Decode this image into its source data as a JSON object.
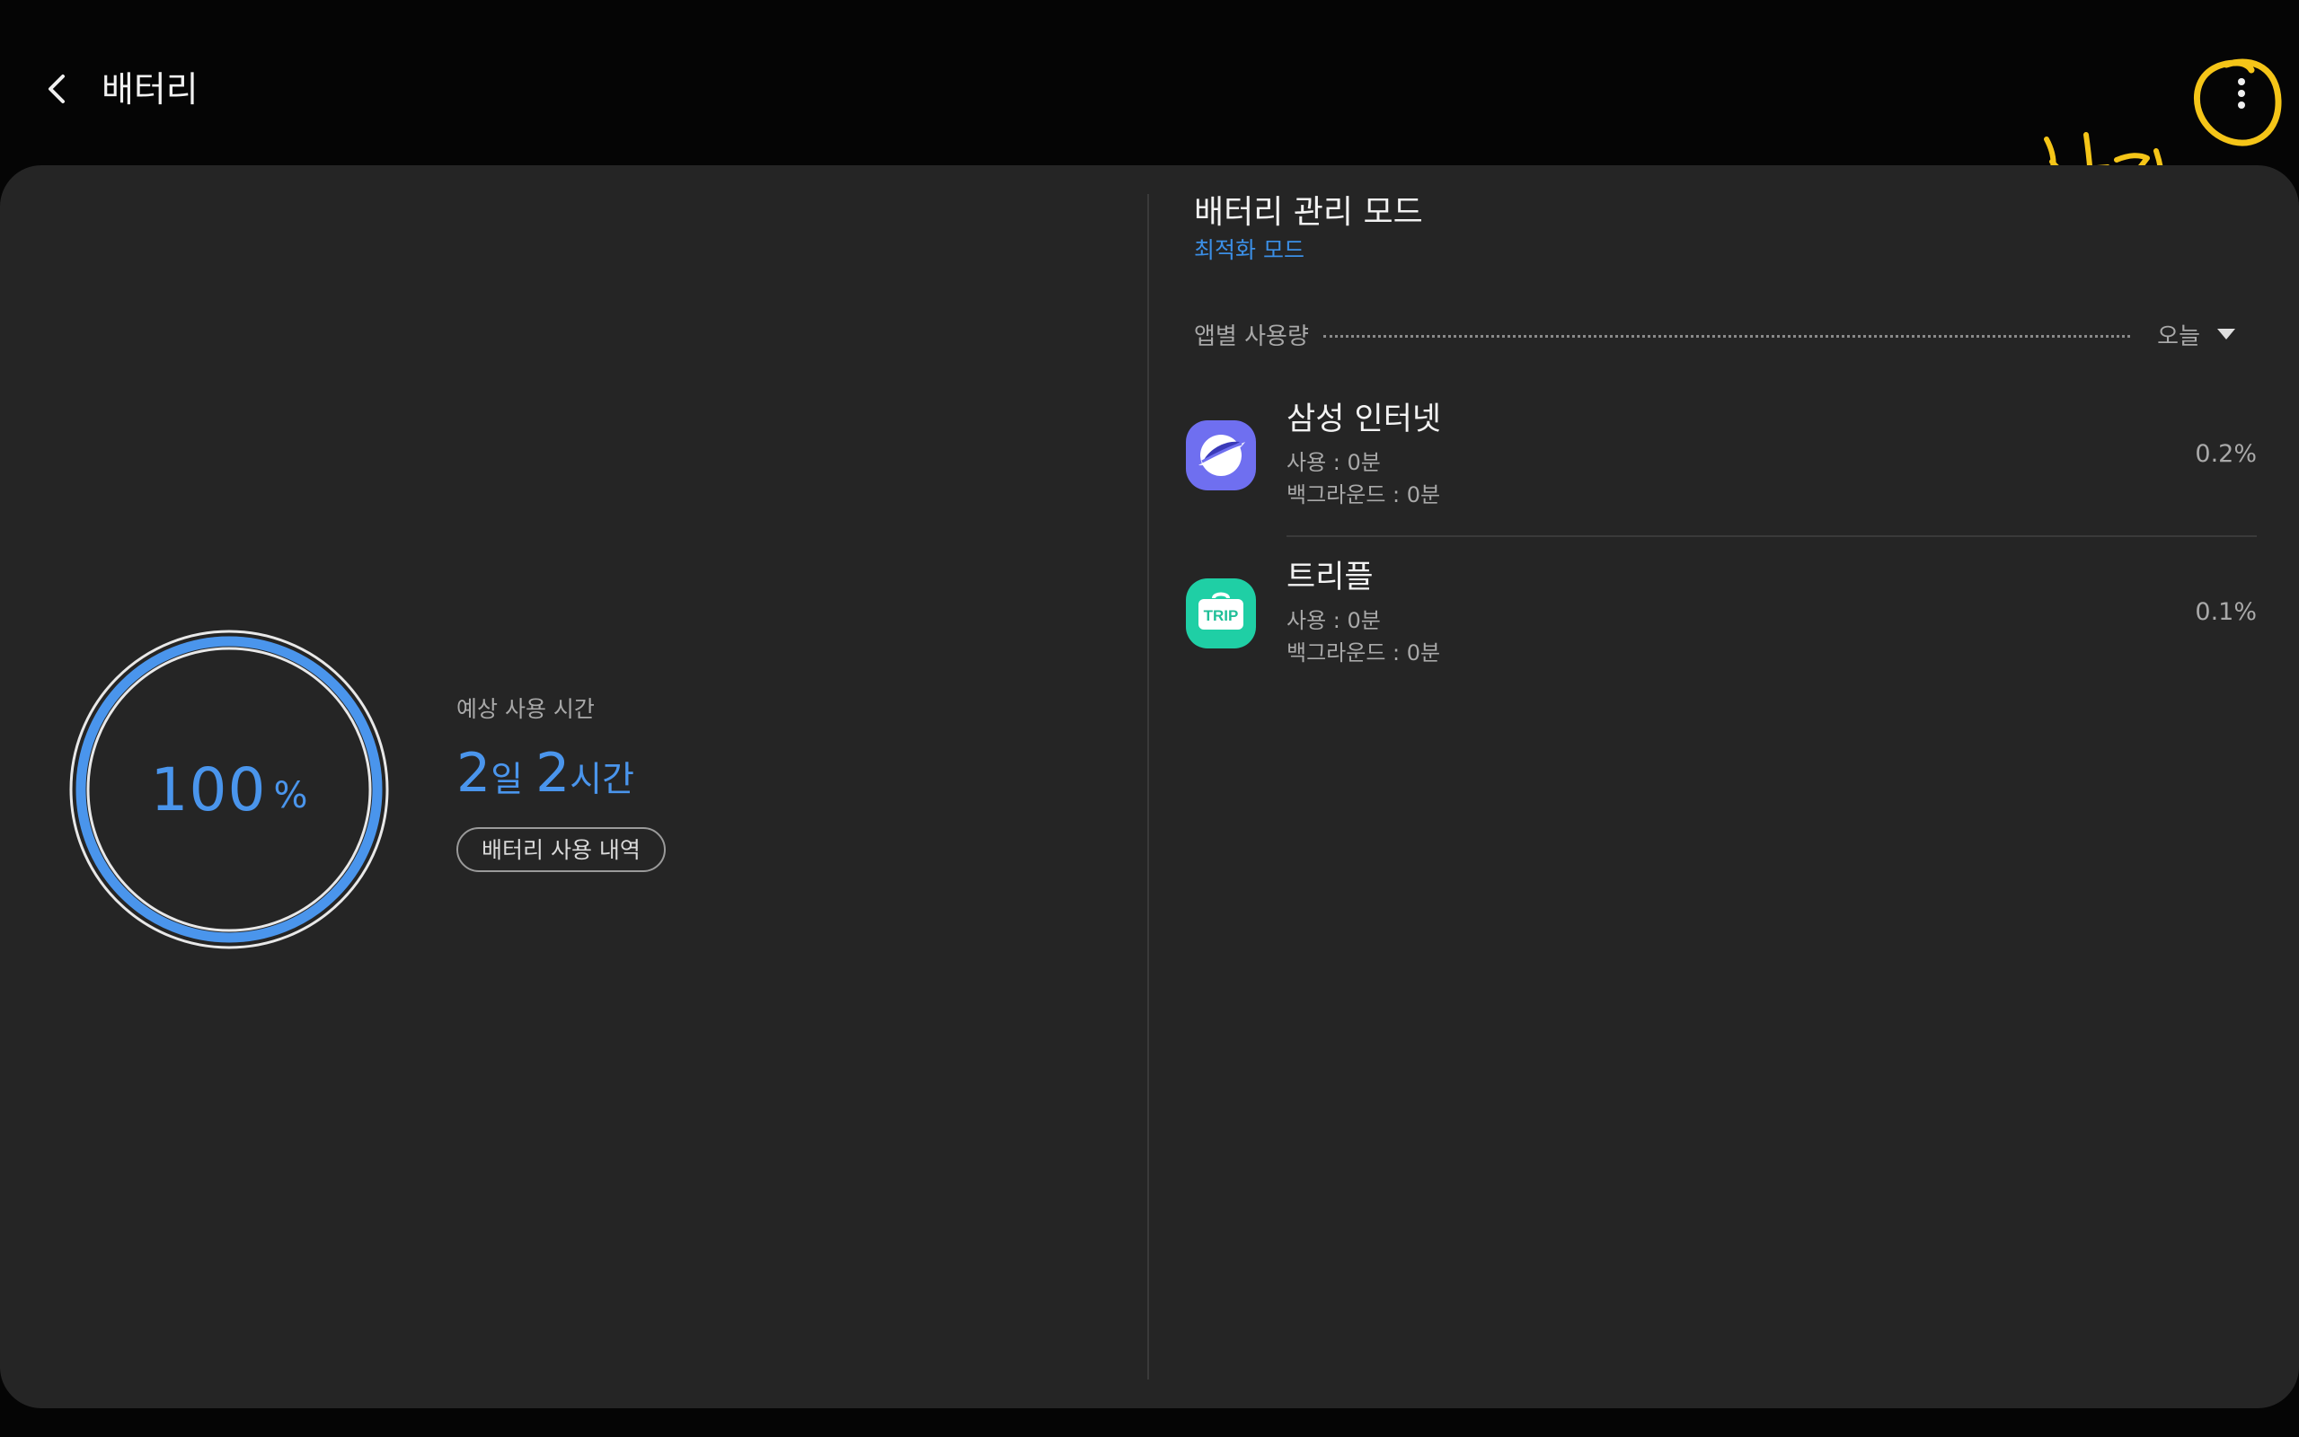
{
  "header": {
    "title": "배터리",
    "back_icon": "chevron-left-icon",
    "more_icon": "more-vertical-icon"
  },
  "annotation": {
    "text": "설정",
    "color": "#f5c518"
  },
  "battery": {
    "level_percent": 100,
    "level_value": "100",
    "level_unit": "%",
    "estimate_label": "예상 사용 시간",
    "estimate_days": "2",
    "estimate_days_unit": "일",
    "estimate_hours": "2",
    "estimate_hours_unit": "시간",
    "history_button": "배터리 사용 내역",
    "ring_color": "#4a95ec"
  },
  "power_mode": {
    "title": "배터리 관리 모드",
    "value": "최적화 모드"
  },
  "usage": {
    "label": "앱별 사용량",
    "period": "오늘",
    "apps": [
      {
        "name": "삼성 인터넷",
        "icon": "samsung-internet-icon",
        "usage": "사용 : 0분",
        "background": "백그라운드 : 0분",
        "percent": "0.2%"
      },
      {
        "name": "트리플",
        "icon": "triple-trip-icon",
        "icon_text": "TRIP",
        "usage": "사용 : 0분",
        "background": "백그라운드 : 0분",
        "percent": "0.1%"
      }
    ]
  },
  "colors": {
    "accent": "#4a95ec",
    "background": "#050505",
    "card": "#252525"
  }
}
